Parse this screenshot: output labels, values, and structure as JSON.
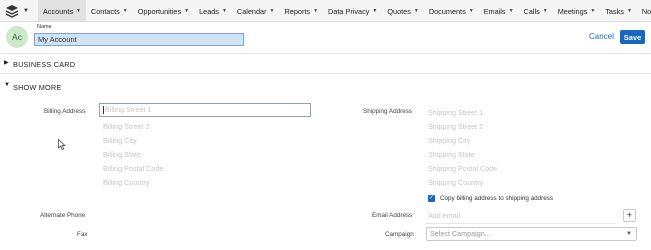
{
  "nav": {
    "items": [
      {
        "label": "Accounts",
        "active": true
      },
      {
        "label": "Contacts"
      },
      {
        "label": "Opportunities"
      },
      {
        "label": "Leads"
      },
      {
        "label": "Calendar"
      },
      {
        "label": "Reports"
      },
      {
        "label": "Data Privacy"
      },
      {
        "label": "Quotes"
      },
      {
        "label": "Documents"
      },
      {
        "label": "Emails"
      },
      {
        "label": "Calls"
      },
      {
        "label": "Meetings"
      },
      {
        "label": "Tasks"
      },
      {
        "label": "Not"
      }
    ],
    "logo_icon": "layers-icon"
  },
  "header": {
    "avatar_initials": "Ac",
    "name_label": "Name",
    "name_value": "My Account",
    "cancel_label": "Cancel",
    "save_label": "Save"
  },
  "sections": {
    "business_card": "BUSINESS CARD",
    "show_more": "SHOW MORE"
  },
  "billing": {
    "label": "Billing Address",
    "street1_placeholder": "Billing Street 1",
    "street2_placeholder": "Billing Street 2",
    "city_placeholder": "Billing City",
    "state_placeholder": "Billing State",
    "postal_placeholder": "Billing Postal Code",
    "country_placeholder": "Billing Country"
  },
  "shipping": {
    "label": "Shipping Address",
    "street1_placeholder": "Shipping Street 1",
    "street2_placeholder": "Shipping Street 2",
    "city_placeholder": "Shipping City",
    "state_placeholder": "Shipping State",
    "postal_placeholder": "Shipping Postal Code",
    "country_placeholder": "Shipping Country",
    "copy_checkbox_label": "Copy billing address to shipping address",
    "copy_checked": true
  },
  "fields": {
    "alternate_phone_label": "Alternate Phone",
    "fax_label": "Fax",
    "email_label": "Email Address",
    "email_placeholder": "Add email",
    "campaign_label": "Campaign",
    "campaign_placeholder": "Select Campaign..."
  },
  "colors": {
    "accent": "#1766c2",
    "avatar_bg": "#cde9cc",
    "name_input_bg": "#cfe3f5"
  }
}
